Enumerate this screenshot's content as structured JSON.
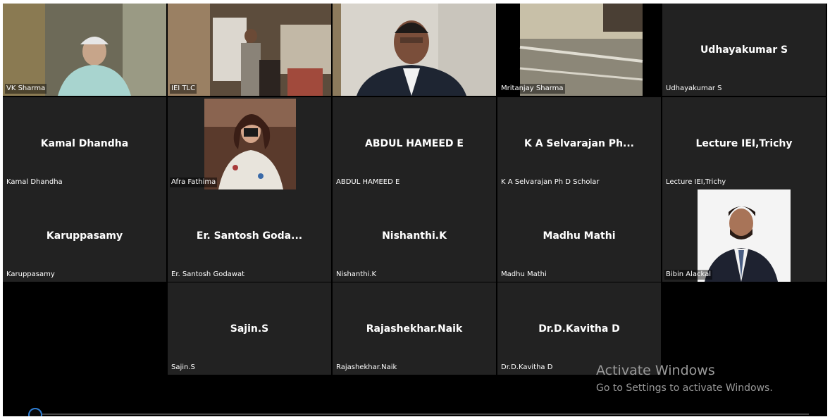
{
  "participants": [
    {
      "name": "VK Sharma"
    },
    {
      "name": "IEI TLC"
    },
    {
      "name": ""
    },
    {
      "name": "Mritanjay Sharma"
    },
    {
      "display": "Udhayakumar S",
      "name": "Udhayakumar S"
    },
    {
      "display": "Kamal Dhandha",
      "name": "Kamal Dhandha"
    },
    {
      "name": "Afra Fathima"
    },
    {
      "display": "ABDUL HAMEED E",
      "name": "ABDUL HAMEED E"
    },
    {
      "display": "K A Selvarajan Ph...",
      "name": "K A Selvarajan Ph D Scholar"
    },
    {
      "display": "Lecture IEI,Trichy",
      "name": "Lecture IEI,Trichy"
    },
    {
      "display": "Karuppasamy",
      "name": "Karuppasamy"
    },
    {
      "display": "Er. Santosh Goda...",
      "name": "Er. Santosh Godawat"
    },
    {
      "display": "Nishanthi.K",
      "name": "Nishanthi.K"
    },
    {
      "display": "Madhu Mathi",
      "name": "Madhu Mathi"
    },
    {
      "name": "Bibin Alackal"
    },
    {
      "display": "Sajin.S",
      "name": "Sajin.S"
    },
    {
      "display": "Rajashekhar.Naik",
      "name": "Rajashekhar.Naik"
    },
    {
      "display": "Dr.D.Kavitha D",
      "name": "Dr.D.Kavitha D"
    }
  ],
  "watermark": {
    "title": "Activate Windows",
    "subtitle": "Go to Settings to activate Windows."
  },
  "colors": {
    "tile_bg": "#222222",
    "stage_bg": "#000000",
    "seek_accent": "#2f7fd6"
  }
}
